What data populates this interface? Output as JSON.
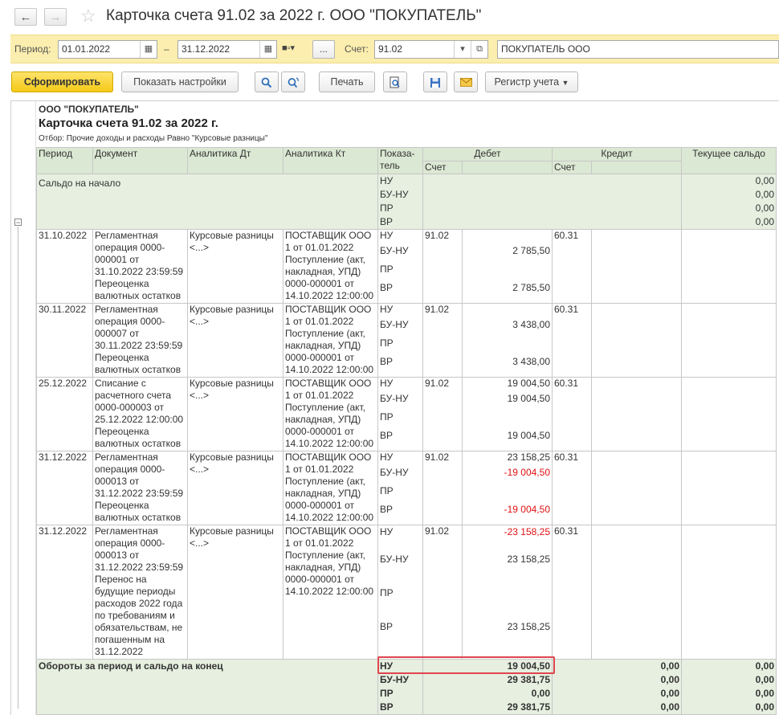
{
  "window": {
    "title": "Карточка счета 91.02 за 2022 г. ООО \"ПОКУПАТЕЛЬ\""
  },
  "params": {
    "period_label": "Период:",
    "date_from": "01.01.2022",
    "dash": "–",
    "date_to": "31.12.2022",
    "dots": "...",
    "account_label": "Счет:",
    "account": "91.02",
    "org": "ПОКУПАТЕЛЬ ООО"
  },
  "toolbar": {
    "generate": "Сформировать",
    "show_settings": "Показать настройки",
    "print": "Печать",
    "ledger": "Регистр учета"
  },
  "report": {
    "org": "ООО \"ПОКУПАТЕЛЬ\"",
    "title": "Карточка счета 91.02 за 2022 г.",
    "filter": "Отбор: Прочие доходы и расходы Равно \"Курсовые разницы\"",
    "headers": {
      "period": "Период",
      "document": "Документ",
      "analytics_dt": "Аналитика Дт",
      "analytics_kt": "Аналитика Кт",
      "indicator": "Показа-тель",
      "debit": "Дебет",
      "credit": "Кредит",
      "balance": "Текущее сальдо",
      "account": "Счет"
    },
    "opening": {
      "label": "Сальдо на начало",
      "indicators": [
        "НУ",
        "БУ-НУ",
        "ПР",
        "ВР"
      ],
      "balances": [
        "0,00",
        "0,00",
        "0,00",
        "0,00"
      ]
    },
    "rows": [
      {
        "date": "31.10.2022",
        "document": "Регламентная операция 0000-000001 от 31.10.2022 23:59:59 Переоценка валютных остатков",
        "dt": "Курсовые разницы <...>",
        "kt": "ПОСТАВЩИК ООО 1 от 01.01.2022 Поступление (акт, накладная, УПД) 0000-000001 от 14.10.2022 12:00:00",
        "debit_account": "91.02",
        "credit_account": "60.31",
        "indicators": [
          "НУ",
          "БУ-НУ",
          "ПР",
          "ВР"
        ],
        "amounts": [
          "",
          "2 785,50",
          "",
          "2 785,50"
        ]
      },
      {
        "date": "30.11.2022",
        "document": "Регламентная операция 0000-000007 от 30.11.2022 23:59:59 Переоценка валютных остатков",
        "dt": "Курсовые разницы <...>",
        "kt": "ПОСТАВЩИК ООО 1 от 01.01.2022 Поступление (акт, накладная, УПД) 0000-000001 от 14.10.2022 12:00:00",
        "debit_account": "91.02",
        "credit_account": "60.31",
        "indicators": [
          "НУ",
          "БУ-НУ",
          "ПР",
          "ВР"
        ],
        "amounts": [
          "",
          "3 438,00",
          "",
          "3 438,00"
        ]
      },
      {
        "date": "25.12.2022",
        "document": "Списание с расчетного счета 0000-000003 от 25.12.2022 12:00:00 Переоценка валютных остатков",
        "dt": "Курсовые разницы <...>",
        "kt": "ПОСТАВЩИК ООО 1 от 01.01.2022 Поступление (акт, накладная, УПД) 0000-000001 от 14.10.2022 12:00:00",
        "debit_account": "91.02",
        "credit_account": "60.31",
        "indicators": [
          "НУ",
          "БУ-НУ",
          "ПР",
          "ВР"
        ],
        "amounts": [
          "19 004,50",
          "19 004,50",
          "",
          "19 004,50"
        ]
      },
      {
        "date": "31.12.2022",
        "document": "Регламентная операция 0000-000013 от 31.12.2022 23:59:59 Переоценка валютных остатков",
        "dt": "Курсовые разницы <...>",
        "kt": "ПОСТАВЩИК ООО 1 от 01.01.2022 Поступление (акт, накладная, УПД) 0000-000001 от 14.10.2022 12:00:00",
        "debit_account": "91.02",
        "credit_account": "60.31",
        "indicators": [
          "НУ",
          "БУ-НУ",
          "ПР",
          "ВР"
        ],
        "amounts": [
          "23 158,25",
          "-19 004,50",
          "",
          "-19 004,50"
        ]
      },
      {
        "date": "31.12.2022",
        "document": "Регламентная операция 0000-000013 от 31.12.2022 23:59:59 Перенос на будущие периоды расходов 2022 года по требованиям и обязательствам, не погашенным на 31.12.2022",
        "dt": "Курсовые разницы <...>",
        "kt": "ПОСТАВЩИК ООО 1 от 01.01.2022 Поступление (акт, накладная, УПД) 0000-000001 от 14.10.2022 12:00:00",
        "debit_account": "91.02",
        "credit_account": "60.31",
        "indicators": [
          "НУ",
          "БУ-НУ",
          "ПР",
          "ВР"
        ],
        "amounts": [
          "-23 158,25",
          "23 158,25",
          "",
          "23 158,25"
        ]
      }
    ],
    "totals": {
      "label": "Обороты за период и сальдо на конец",
      "indicators": [
        "НУ",
        "БУ-НУ",
        "ПР",
        "ВР"
      ],
      "debit": [
        "19 004,50",
        "29 381,75",
        "0,00",
        "29 381,75"
      ],
      "credit": [
        "0,00",
        "0,00",
        "0,00",
        "0,00"
      ],
      "balance": [
        "0,00",
        "0,00",
        "0,00",
        "0,00"
      ]
    }
  }
}
